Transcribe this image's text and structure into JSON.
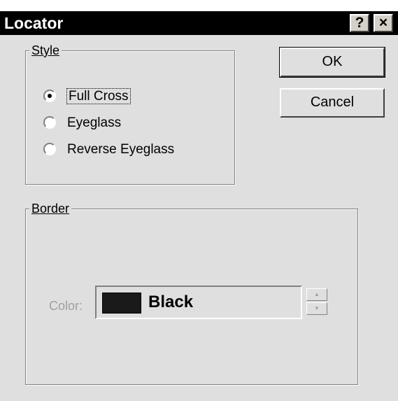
{
  "window": {
    "title": "Locator",
    "help_glyph": "?",
    "close_glyph": "×"
  },
  "style_group": {
    "legend": "Style",
    "options": [
      {
        "label": "Full Cross",
        "selected": true
      },
      {
        "label": "Eyeglass",
        "selected": false
      },
      {
        "label": "Reverse Eyeglass",
        "selected": false
      }
    ]
  },
  "buttons": {
    "ok": "OK",
    "cancel": "Cancel"
  },
  "border_group": {
    "legend": "Border",
    "color_label": "Color:",
    "color_value": "Black",
    "swatch_color": "#1a1a1a"
  }
}
